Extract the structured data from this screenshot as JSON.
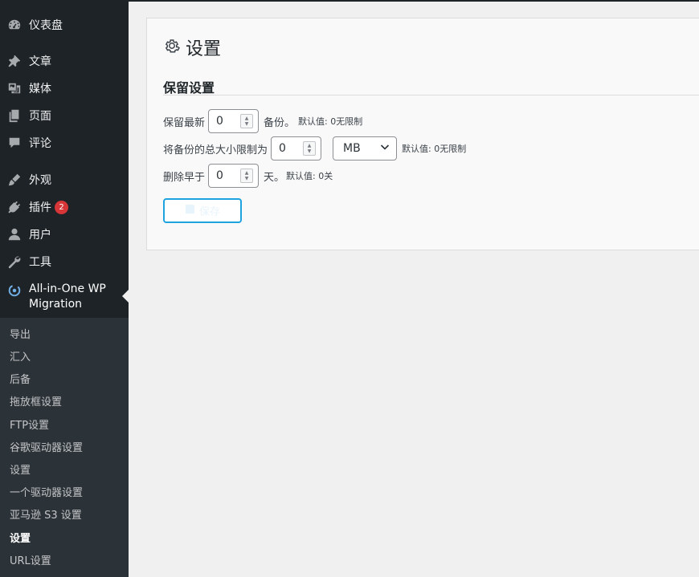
{
  "sidebar": {
    "items": [
      {
        "label": "仪表盘",
        "icon": "dashboard-icon"
      },
      {
        "label": "文章",
        "icon": "pin-icon"
      },
      {
        "label": "媒体",
        "icon": "media-icon"
      },
      {
        "label": "页面",
        "icon": "pages-icon"
      },
      {
        "label": "评论",
        "icon": "comments-icon"
      },
      {
        "label": "外观",
        "icon": "brush-icon"
      },
      {
        "label": "插件",
        "icon": "plugin-icon",
        "badge": "2"
      },
      {
        "label": "用户",
        "icon": "user-icon"
      },
      {
        "label": "工具",
        "icon": "wrench-icon"
      }
    ],
    "plugin_menu": {
      "label_line1": "All-in-One WP",
      "label_line2": "Migration",
      "icon": "aio-migration-icon"
    },
    "submenu": [
      "导出",
      "汇入",
      "后备",
      "拖放框设置",
      "FTP设置",
      "谷歌驱动器设置",
      "设置",
      "一个驱动器设置",
      "亚马逊 S3 设置",
      "设置",
      "URL设置"
    ],
    "submenu_current_index": 9
  },
  "main": {
    "title": "设置",
    "title_icon": "gear-icon",
    "section_title": "保留设置",
    "rows": {
      "keep_latest": {
        "prefix": "保留最新",
        "value": "0",
        "suffix": "备份。",
        "hint": "默认值:  0无限制"
      },
      "total_size": {
        "prefix": "将备份的总大小限制为",
        "value": "0",
        "unit": "MB",
        "hint": "默认值:  0无限制"
      },
      "delete_older": {
        "prefix": "删除早于",
        "value": "0",
        "suffix": "天。",
        "hint": "默认值: 0关"
      }
    },
    "save_label": "保存",
    "save_icon": "save-icon"
  },
  "colors": {
    "sidebar_bg": "#1d2327",
    "submenu_bg": "#2c3338",
    "badge": "#d63638",
    "accent": "#1fa3de"
  }
}
